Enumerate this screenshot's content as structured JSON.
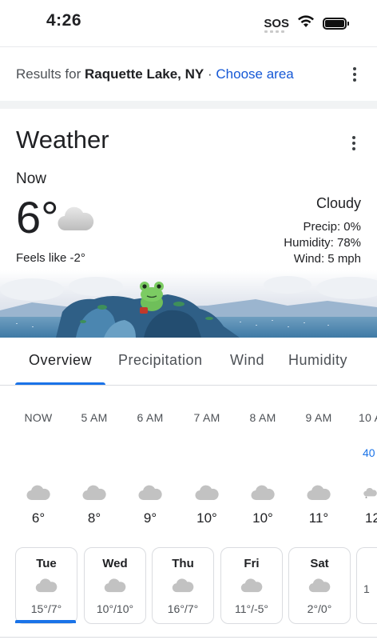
{
  "status_bar": {
    "time": "4:26",
    "sos": "SOS"
  },
  "results": {
    "prefix": "Results for",
    "location": "Raquette Lake, NY",
    "separator": "·",
    "choose_area": "Choose area"
  },
  "weather": {
    "title": "Weather",
    "now_label": "Now",
    "temperature": "6°",
    "feels_like": "Feels like -2°",
    "condition": "Cloudy",
    "precip": "Precip: 0%",
    "humidity": "Humidity: 78%",
    "wind": "Wind: 5 mph",
    "icon": "cloud-icon"
  },
  "tabs": [
    {
      "label": "Overview",
      "active": true
    },
    {
      "label": "Precipitation",
      "active": false
    },
    {
      "label": "Wind",
      "active": false
    },
    {
      "label": "Humidity",
      "active": false
    }
  ],
  "hourly": [
    {
      "time": "NOW",
      "temp": "6°",
      "icon": "cloud-icon"
    },
    {
      "time": "5 AM",
      "temp": "8°",
      "icon": "cloud-icon"
    },
    {
      "time": "6 AM",
      "temp": "9°",
      "icon": "cloud-icon"
    },
    {
      "time": "7 AM",
      "temp": "10°",
      "icon": "cloud-icon"
    },
    {
      "time": "8 AM",
      "temp": "10°",
      "icon": "cloud-icon"
    },
    {
      "time": "9 AM",
      "temp": "11°",
      "icon": "cloud-icon"
    },
    {
      "time": "10 A",
      "temp": "12",
      "icon": "cloud-snow-icon",
      "extra": "40"
    }
  ],
  "daily": [
    {
      "day": "Tue",
      "temps": "15°/7°",
      "icon": "cloud-icon",
      "active": true
    },
    {
      "day": "Wed",
      "temps": "10°/10°",
      "icon": "cloud-icon",
      "active": false
    },
    {
      "day": "Thu",
      "temps": "16°/7°",
      "icon": "cloud-icon",
      "active": false
    },
    {
      "day": "Fri",
      "temps": "11°/-5°",
      "icon": "cloud-icon",
      "active": false
    },
    {
      "day": "Sat",
      "temps": "2°/0°",
      "icon": "cloud-icon",
      "active": false
    },
    {
      "day": "",
      "temps": "1",
      "icon": "",
      "active": false
    }
  ],
  "colors": {
    "accent": "#1a73e8",
    "link": "#1558d6",
    "text": "#202124",
    "secondary_text": "#4d5156"
  }
}
